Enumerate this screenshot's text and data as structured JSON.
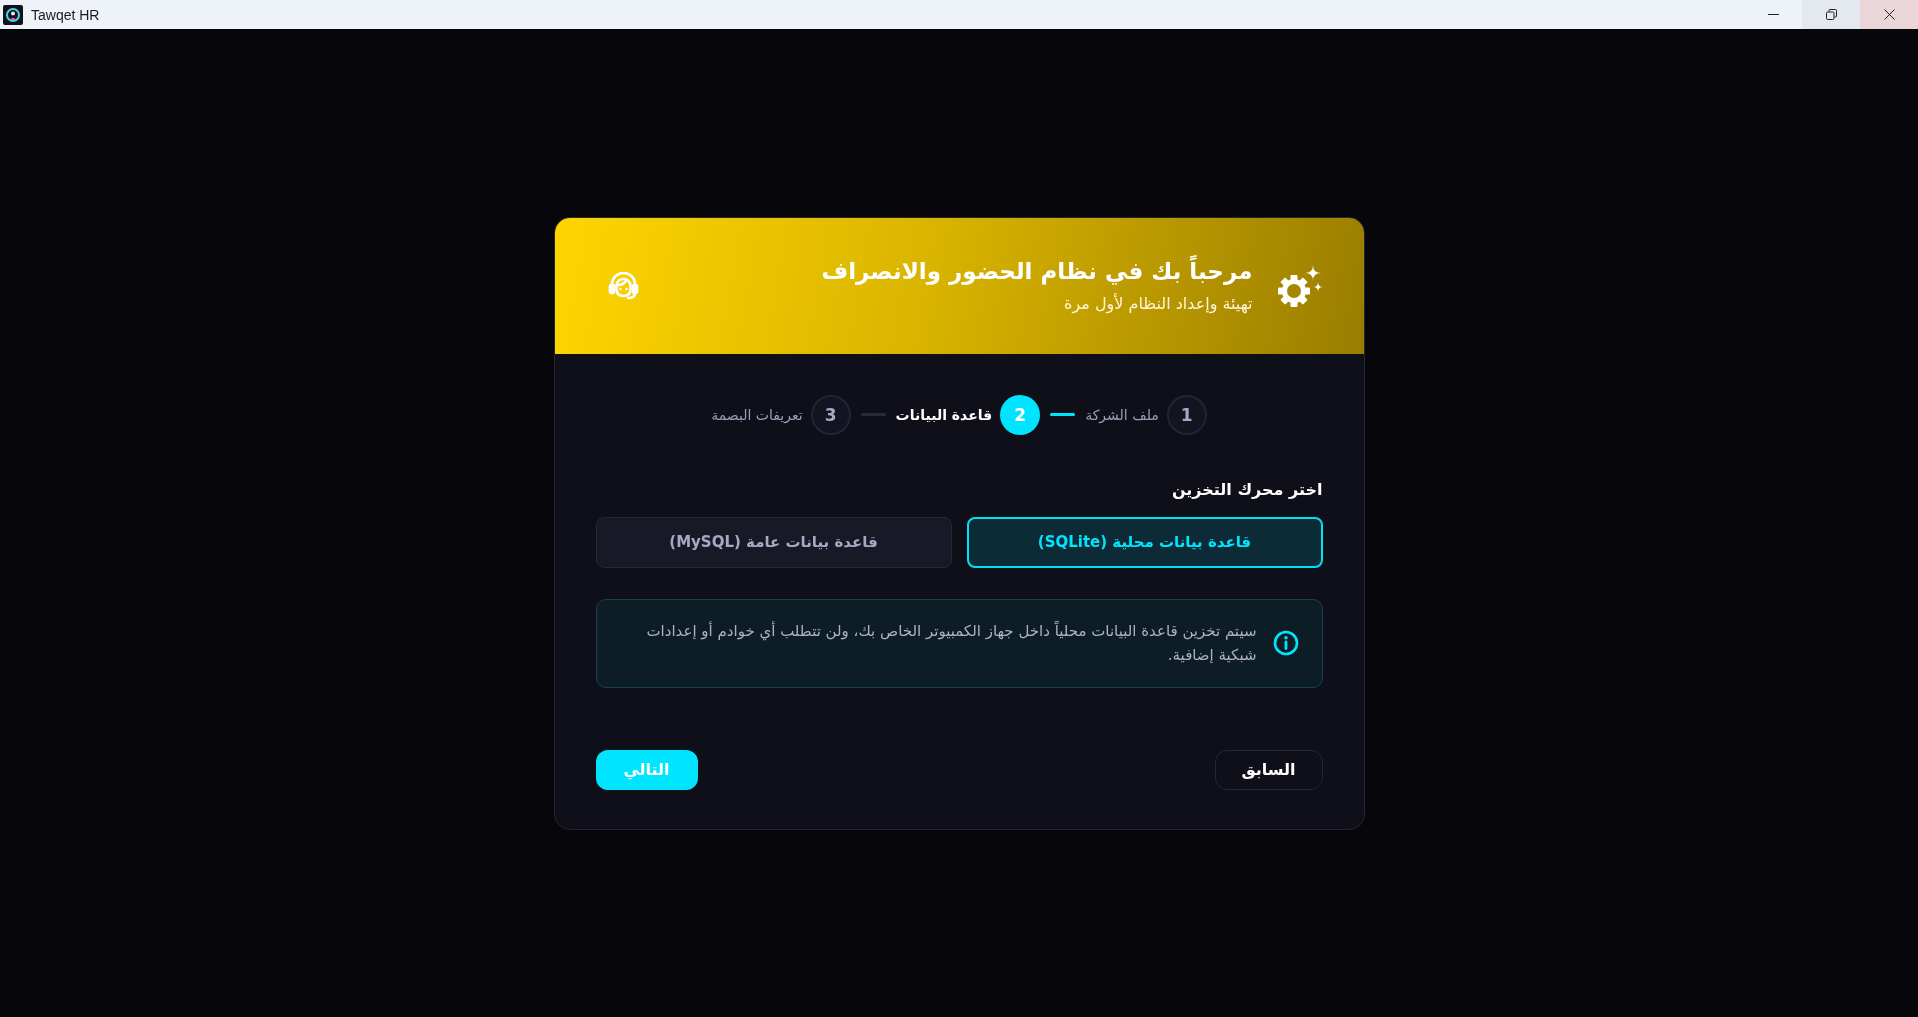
{
  "window": {
    "title": "Tawqet HR"
  },
  "wizard": {
    "header": {
      "title": "مرحباً بك في نظام الحضور والانصراف",
      "subtitle": "تهيئة وإعداد النظام لأول مرة"
    },
    "steps": [
      {
        "number": "1",
        "label": "ملف الشركة",
        "selected": false
      },
      {
        "number": "2",
        "label": "قاعدة البيانات",
        "selected": true
      },
      {
        "number": "3",
        "label": "تعريفات البصمة",
        "selected": false
      }
    ],
    "storage": {
      "label": "اختر محرك التخزين",
      "options": [
        {
          "label": "قاعدة بيانات محلية (SQLite)",
          "selected": true
        },
        {
          "label": "قاعدة بيانات عامة (MySQL)",
          "selected": false
        }
      ],
      "note": "سيتم تخزين قاعدة البيانات محلياً داخل جهاز الكمبيوتر الخاص بك، ولن تتطلب أي خوادم أو إعدادات شبكية إضافية."
    },
    "buttons": {
      "back": "السابق",
      "next": "التالي"
    }
  }
}
